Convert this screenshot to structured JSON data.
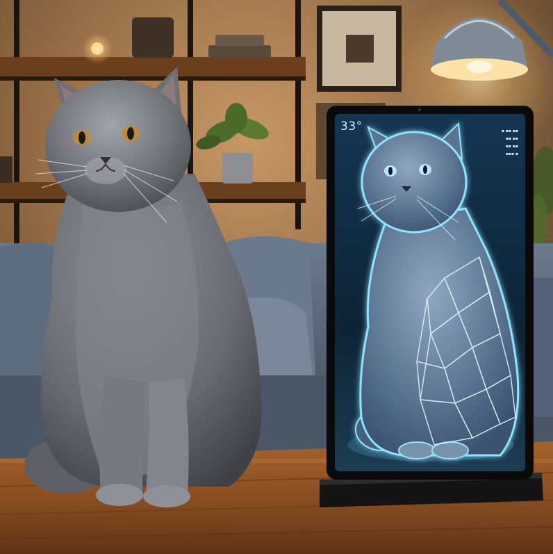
{
  "scene": {
    "description_subjects": [
      "gray-cat",
      "tablet-display",
      "holographic-cat",
      "wooden-table",
      "sofa",
      "shelving",
      "pendant-lamp"
    ],
    "colors": {
      "wall_warm": "#b98a5c",
      "shadow": "#1c1712",
      "cat_fur": "#6f7177",
      "cat_fur_light": "#9a9ca3",
      "cat_eye": "#b98d3a",
      "screen_bg": "#0d2436",
      "hologram_glow": "#6fd3ff",
      "table_wood": "#8a4e22",
      "sofa": "#59677a",
      "lamp_light": "#ffd48a"
    }
  },
  "tablet": {
    "temperature": "33°",
    "status_lines": [
      "▪ ▪▪ ▪▪",
      "▪▪ ▪▪",
      "▪▪ ▪▪",
      "▪▪▪ ▪"
    ]
  }
}
